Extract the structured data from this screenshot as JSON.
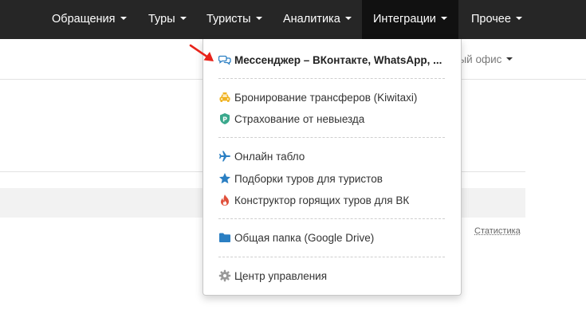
{
  "nav": {
    "items": [
      {
        "label": "Обращения"
      },
      {
        "label": "Туры"
      },
      {
        "label": "Туристы"
      },
      {
        "label": "Аналитика"
      },
      {
        "label": "Интеграции"
      },
      {
        "label": "Прочее"
      }
    ]
  },
  "page": {
    "office_label": "ный офис",
    "stats_link": "Статистика"
  },
  "dropdown": {
    "items": [
      {
        "label": "Мессенджер – ВКонтакте, WhatsApp, ...",
        "icon": "chat-bubbles-icon"
      },
      {
        "label": "Бронирование трансферов (Kiwitaxi)",
        "icon": "taxi-icon"
      },
      {
        "label": "Страхование от невыезда",
        "icon": "shield-icon"
      },
      {
        "label": "Онлайн табло",
        "icon": "airplane-icon"
      },
      {
        "label": "Подборки туров для туристов",
        "icon": "star-icon"
      },
      {
        "label": "Конструктор горящих туров для ВК",
        "icon": "fire-icon"
      },
      {
        "label": "Общая папка (Google Drive)",
        "icon": "folder-icon"
      },
      {
        "label": "Центр управления",
        "icon": "gear-icon"
      }
    ]
  },
  "colors": {
    "navbar": "#262626",
    "nav_active": "#111111",
    "blue_icon": "#2b7fc3",
    "taxi_icon": "#f0b323",
    "shield_icon": "#3aa88c",
    "fire_icon": "#e04f3a",
    "gear_icon": "#999999",
    "arrow": "#e8231a"
  }
}
